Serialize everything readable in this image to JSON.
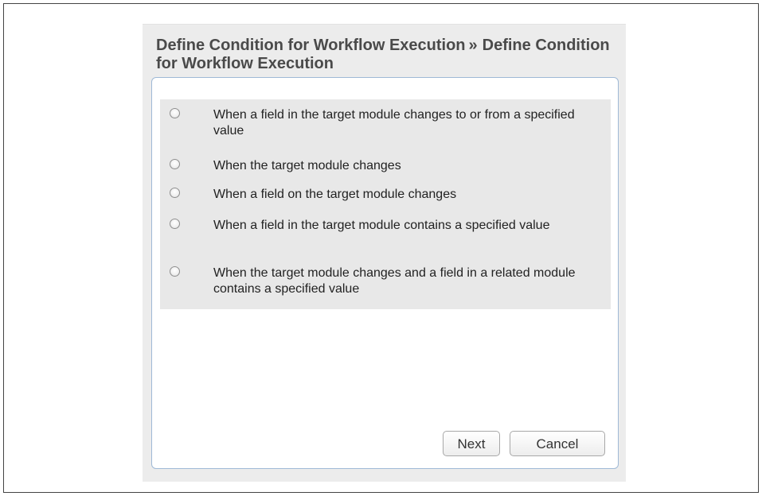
{
  "header": {
    "title_part1": "Define Condition for Workflow Execution",
    "separator": "»",
    "title_part2": "Define Condition for Workflow Execution"
  },
  "options": [
    {
      "label": "When a field in the target module changes to or from a specified value",
      "selected": false
    },
    {
      "label": "When the target module changes",
      "selected": false
    },
    {
      "label": "When a field on the target module changes",
      "selected": false
    },
    {
      "label": "When a field in the target module contains a specified value",
      "selected": false
    },
    {
      "label": "When the target module changes and a field in a related module contains a specified value",
      "selected": false
    }
  ],
  "buttons": {
    "next_label": "Next",
    "cancel_label": "Cancel"
  }
}
